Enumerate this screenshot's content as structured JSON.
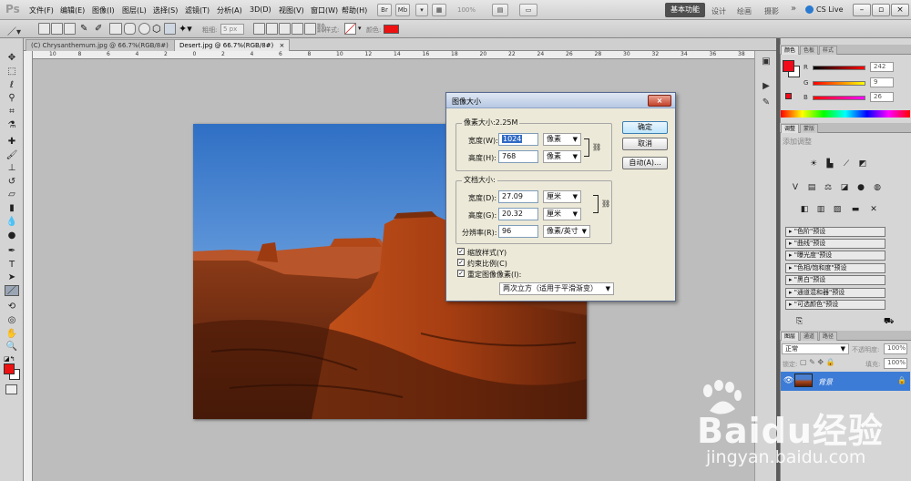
{
  "app": {
    "logo": "Ps"
  },
  "menu": [
    "文件(F)",
    "编辑(E)",
    "图像(I)",
    "图层(L)",
    "选择(S)",
    "滤镜(T)",
    "分析(A)",
    "3D(D)",
    "视图(V)",
    "窗口(W)",
    "帮助(H)"
  ],
  "topbar": {
    "zoom": "100%",
    "workspace_active": "基本功能",
    "workspaces": [
      "设计",
      "绘画",
      "摄影"
    ],
    "more": "»",
    "cs_live": "CS Live"
  },
  "options": {
    "feather_label": "粗细:",
    "feather_value": "5 px",
    "style_label": "样式:",
    "color_label": "颜色:",
    "color": "#ee1111"
  },
  "tabs": [
    {
      "label": "(C) Chrysanthemum.jpg @ 66.7%(RGB/8#)",
      "close": "×"
    },
    {
      "label": "Desert.jpg @ 66.7%(RGB/8#)",
      "close": "×"
    }
  ],
  "ruler_top": [
    "10",
    "8",
    "6",
    "4",
    "2",
    "0",
    "2",
    "4",
    "6",
    "8",
    "10",
    "12",
    "14",
    "16",
    "18",
    "20",
    "22",
    "24",
    "26",
    "28",
    "30",
    "32",
    "34",
    "36",
    "38"
  ],
  "dialog": {
    "title": "图像大小",
    "close": "×",
    "pixel_dims": {
      "title": "像素大小:2.25M",
      "width_label": "宽度(W):",
      "width_value": "1024",
      "width_unit": "像素",
      "height_label": "高度(H):",
      "height_value": "768",
      "height_unit": "像素"
    },
    "doc_size": {
      "title": "文档大小:",
      "width_label": "宽度(D):",
      "width_value": "27.09",
      "width_unit": "厘米",
      "height_label": "高度(G):",
      "height_value": "20.32",
      "height_unit": "厘米",
      "res_label": "分辨率(R):",
      "res_value": "96",
      "res_unit": "像素/英寸"
    },
    "checks": [
      {
        "label": "缩放样式(Y)",
        "checked": true
      },
      {
        "label": "约束比例(C)",
        "checked": true
      },
      {
        "label": "重定图像像素(I):",
        "checked": true
      }
    ],
    "resample": "两次立方（适用于平滑渐变）",
    "ok": "确定",
    "cancel": "取消",
    "auto": "自动(A)..."
  },
  "color_panel": {
    "tabs": [
      "颜色",
      "色板",
      "样式"
    ],
    "channels": [
      {
        "label": "R",
        "value": "242"
      },
      {
        "label": "G",
        "value": "9"
      },
      {
        "label": "B",
        "value": "26"
      }
    ],
    "fg_color": "#f2091a"
  },
  "adjust_panel": {
    "tabs": [
      "调整",
      "蒙版"
    ],
    "title": "添加调整",
    "presets": [
      "\"色阶\"预设",
      "\"曲线\"预设",
      "\"曝光度\"预设",
      "\"色相/饱和度\"预设",
      "\"黑白\"预设",
      "\"通道混和器\"预设",
      "\"可选颜色\"预设"
    ]
  },
  "layers_panel": {
    "tabs": [
      "图层",
      "通道",
      "路径"
    ],
    "blend_mode": "正常",
    "opacity_label": "不透明度:",
    "opacity_value": "100%",
    "lock_label": "锁定:",
    "fill_label": "填充:",
    "fill_value": "100%",
    "layer_name": "背景"
  },
  "watermark": {
    "brand": "Baidu经验",
    "url": "jingyan.baidu.com"
  }
}
